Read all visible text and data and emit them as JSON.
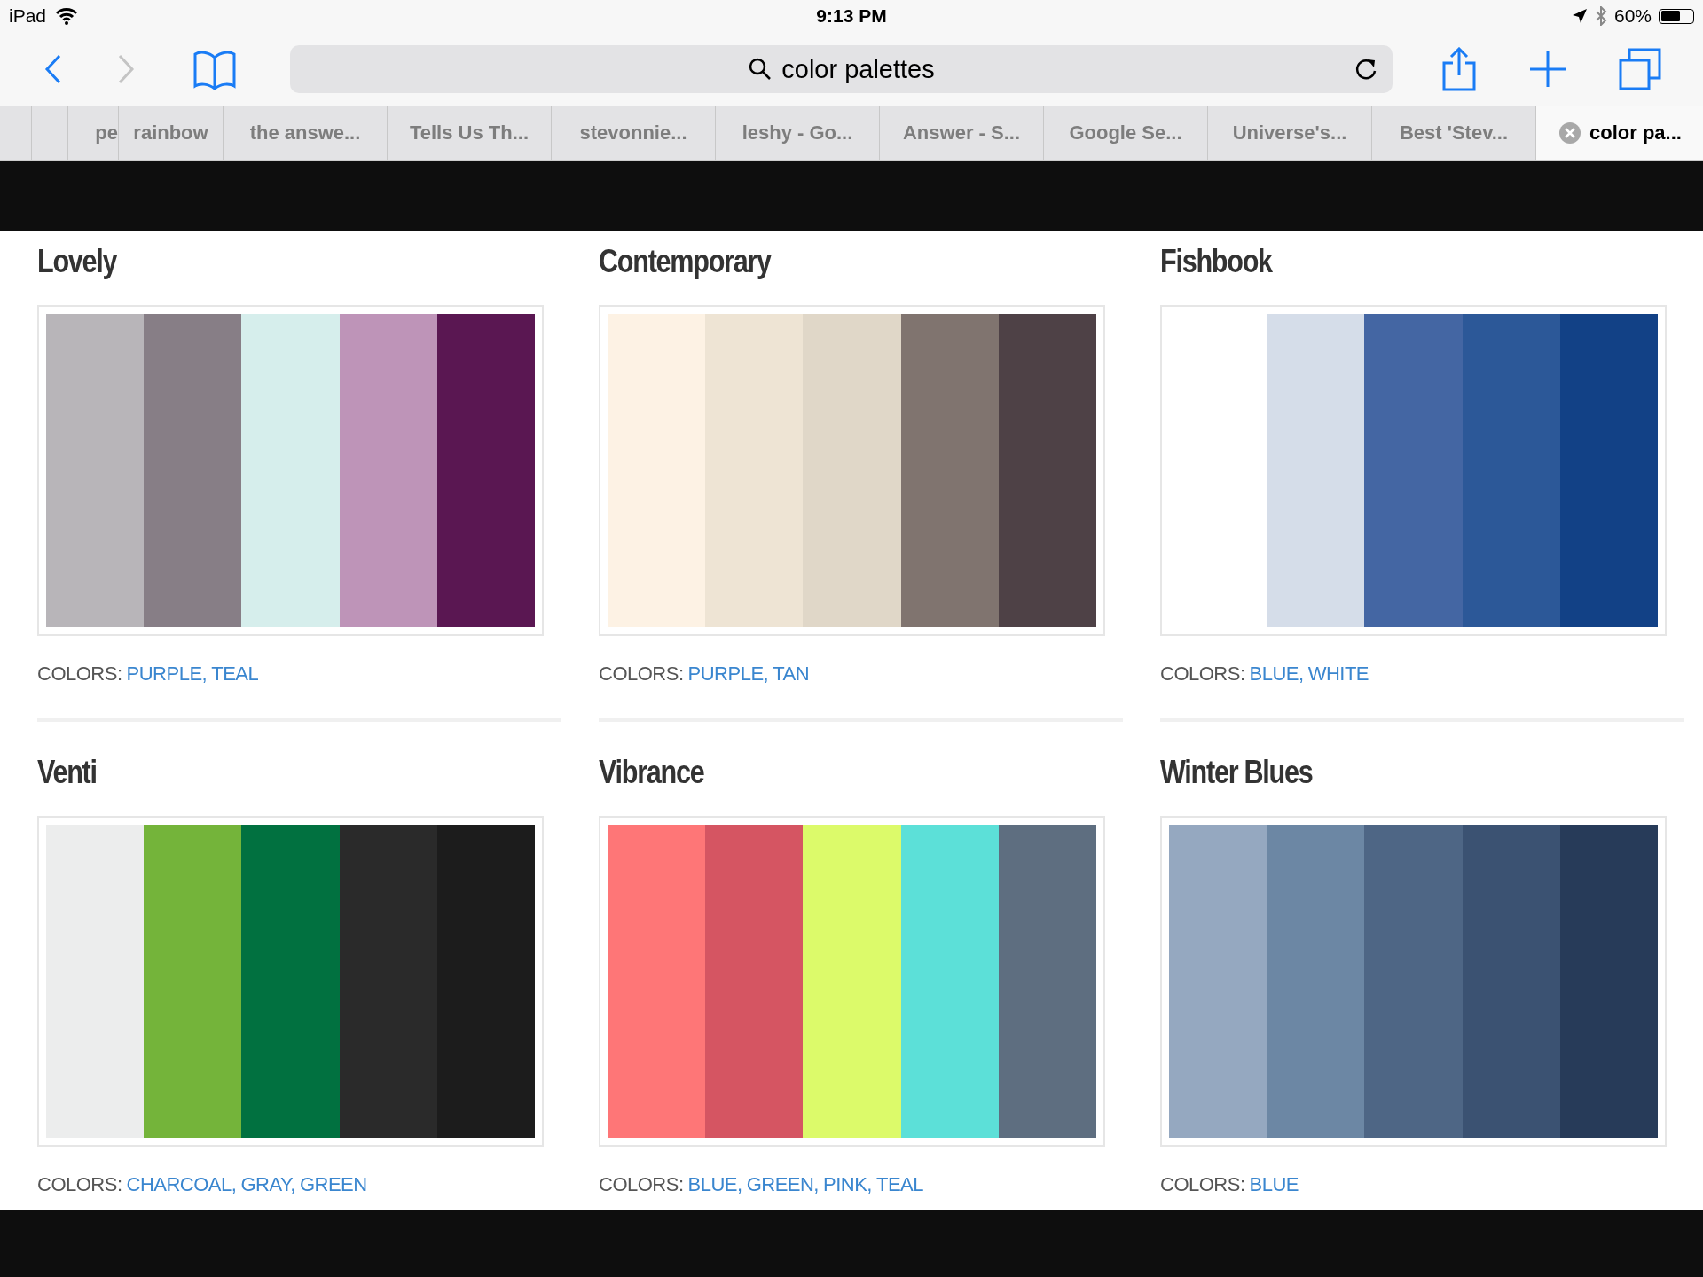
{
  "status_bar": {
    "device": "iPad",
    "time": "9:13 PM",
    "battery": "60%"
  },
  "toolbar": {
    "address": "color palettes"
  },
  "tabs": [
    {
      "label": "pe",
      "selected": false
    },
    {
      "label": "rainbow",
      "selected": false
    },
    {
      "label": "the answe...",
      "selected": false
    },
    {
      "label": "Tells Us Th...",
      "selected": false
    },
    {
      "label": "stevonnie...",
      "selected": false
    },
    {
      "label": "leshy - Go...",
      "selected": false
    },
    {
      "label": "Answer - S...",
      "selected": false
    },
    {
      "label": "Google Se...",
      "selected": false
    },
    {
      "label": "Universe's...",
      "selected": false
    },
    {
      "label": "Best 'Stev...",
      "selected": false
    },
    {
      "label": "color pa...",
      "selected": true
    }
  ],
  "palettes": [
    {
      "title": "Lovely",
      "swatches": [
        {
          "color": "#b8b5b9"
        },
        {
          "color": "#877e86"
        },
        {
          "color": "#d6eeec"
        },
        {
          "color": "#be94b8"
        },
        {
          "color": "#5a1752"
        }
      ],
      "label": "COLORS:",
      "tags": [
        "PURPLE,",
        "TEAL"
      ]
    },
    {
      "title": "Contemporary",
      "swatches": [
        {
          "color": "#fdf2e4"
        },
        {
          "color": "#eee4d4"
        },
        {
          "color": "#e0d7c8"
        },
        {
          "color": "#80746f"
        },
        {
          "color": "#4e4146"
        }
      ],
      "label": "COLORS:",
      "tags": [
        "PURPLE,",
        "TAN"
      ]
    },
    {
      "title": "Fishbook",
      "swatches": [
        {
          "color": "#ffffff"
        },
        {
          "color": "#d5dde9"
        },
        {
          "color": "#4466a3"
        },
        {
          "color": "#2c5898"
        },
        {
          "color": "#124186"
        }
      ],
      "label": "COLORS:",
      "tags": [
        "BLUE,",
        "WHITE"
      ]
    },
    {
      "title": "Venti",
      "swatches": [
        {
          "color": "#eceded"
        },
        {
          "color": "#74b43a"
        },
        {
          "color": "#017140"
        },
        {
          "color": "#2a2a2a"
        },
        {
          "color": "#1c1c1c"
        }
      ],
      "label": "COLORS:",
      "tags": [
        "CHARCOAL,",
        "GRAY,",
        "GREEN"
      ]
    },
    {
      "title": "Vibrance",
      "swatches": [
        {
          "color": "#fe7677"
        },
        {
          "color": "#d55562"
        },
        {
          "color": "#dcfa6a"
        },
        {
          "color": "#5ce0d8"
        },
        {
          "color": "#5e6e80"
        }
      ],
      "label": "COLORS:",
      "tags": [
        "BLUE,",
        "GREEN,",
        "PINK,",
        "TEAL"
      ]
    },
    {
      "title": "Winter Blues",
      "swatches": [
        {
          "color": "#95a8c0"
        },
        {
          "color": "#6c87a4"
        },
        {
          "color": "#4e6685"
        },
        {
          "color": "#3b5272"
        },
        {
          "color": "#273b59"
        }
      ],
      "label": "COLORS:",
      "tags": [
        "BLUE"
      ]
    }
  ]
}
